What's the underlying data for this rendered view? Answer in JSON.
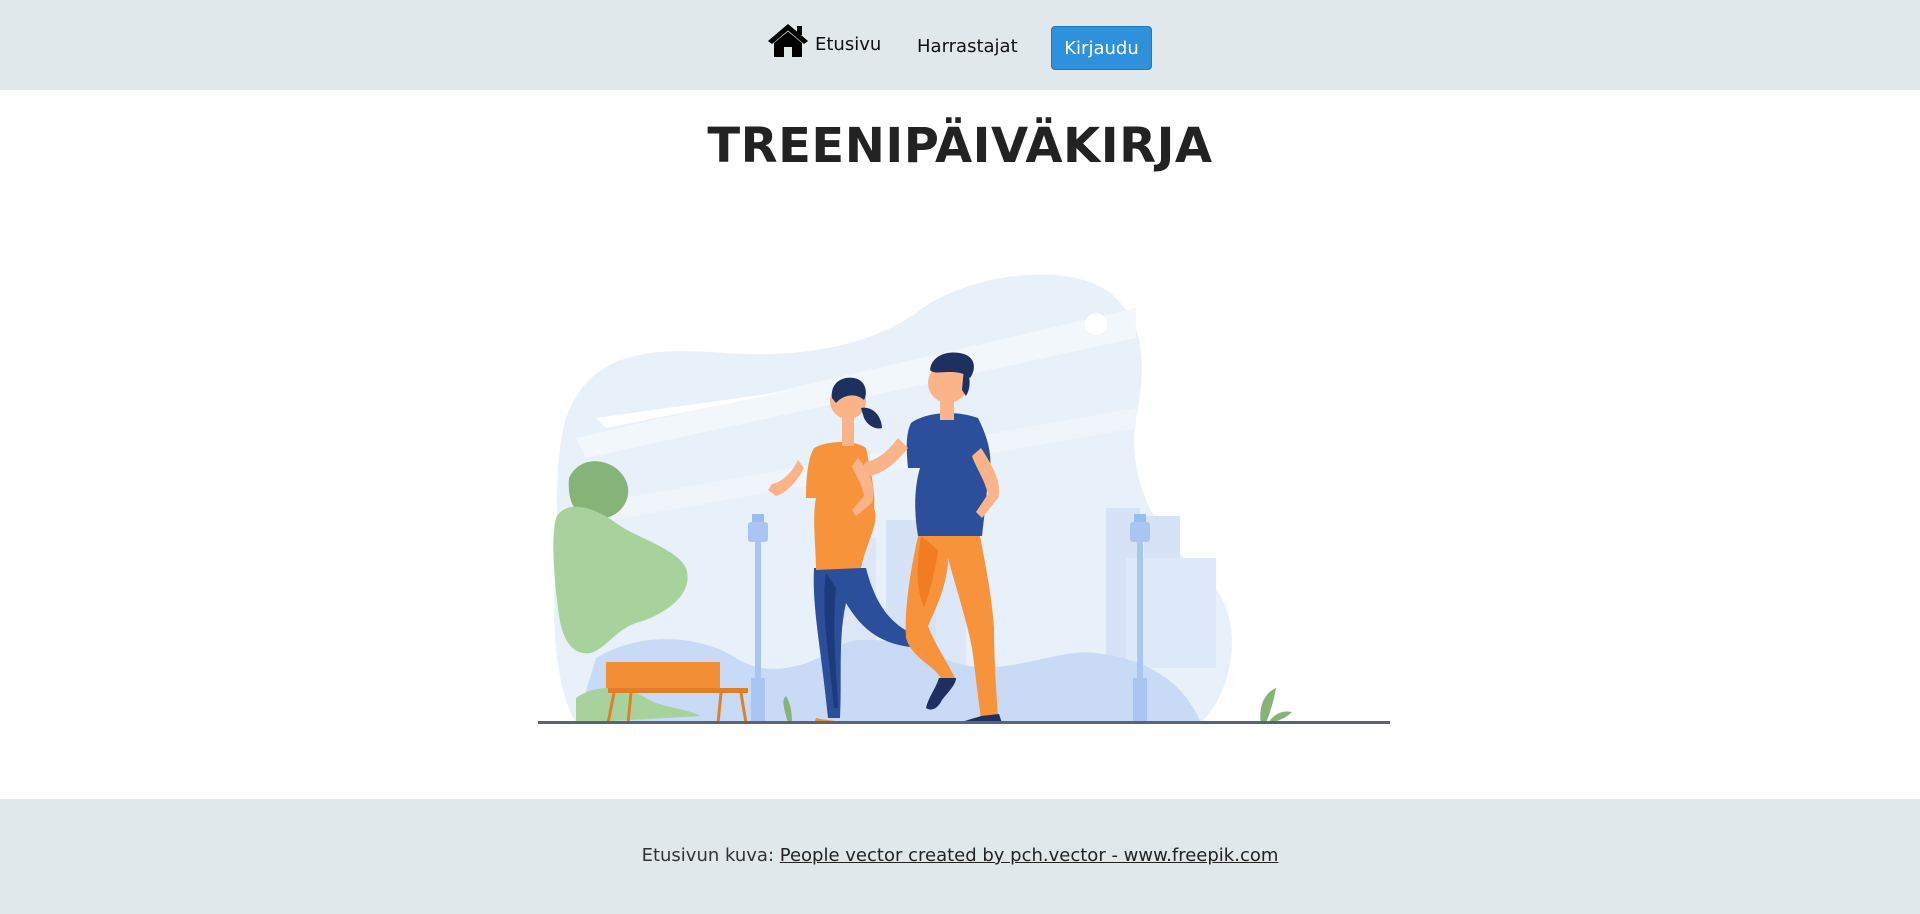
{
  "nav": {
    "home_label": "Etusivu",
    "home_icon": "home-icon",
    "members_label": "Harrastajat",
    "login_label": "Kirjaudu",
    "login_color": "#2f90dc"
  },
  "main": {
    "title": "TREENIPÄIVÄKIRJA"
  },
  "footer": {
    "prefix": "Etusivun kuva:",
    "link_text": "People vector created by pch.vector - www.freepik.com"
  },
  "colors": {
    "header_bg": "#e0e8ec",
    "footer_bg": "#e0e8ec"
  }
}
